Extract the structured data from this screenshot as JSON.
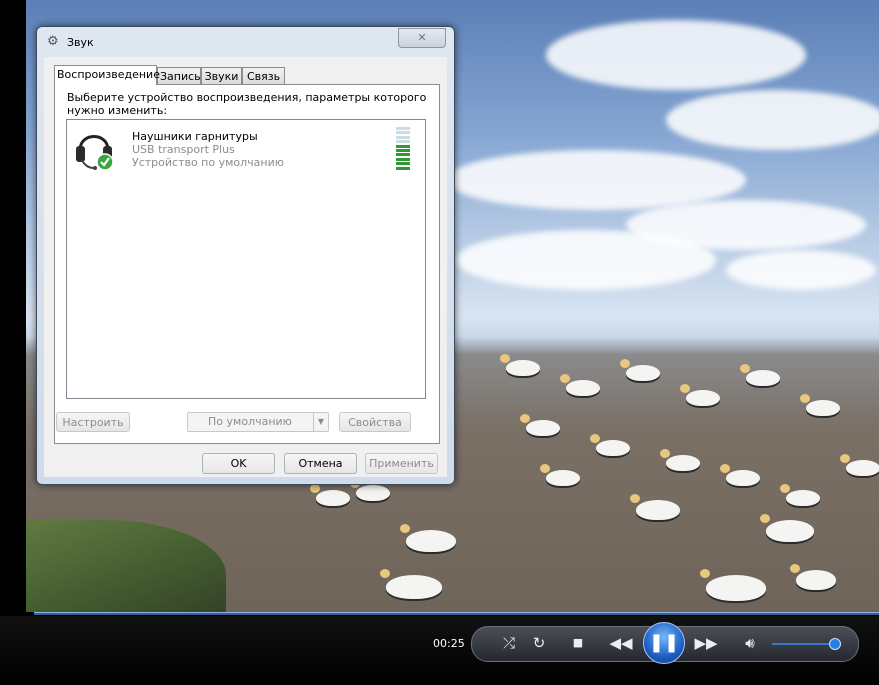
{
  "player": {
    "time": "00:25",
    "seek_progress": 1.0,
    "volume_level": 0.92,
    "icons": [
      "repeat-shuffle-icon",
      "repeat-icon",
      "stop-icon",
      "previous-icon",
      "pause-icon",
      "next-icon",
      "volume-icon"
    ]
  },
  "dialog": {
    "title": "Звук",
    "tabs": [
      "Воспроизведение",
      "Запись",
      "Звуки",
      "Связь"
    ],
    "active_tab": "Воспроизведение",
    "instruction": "Выберите устройство воспроизведения, параметры которого нужно изменить:",
    "device": {
      "name": "Наушники гарнитуры",
      "subtitle": "USB transport Plus",
      "status": "Устройство по умолчанию",
      "level_segments_lit": 6,
      "level_segments_total": 10
    },
    "buttons": {
      "configure": "Настроить",
      "set_default": "По умолчанию",
      "properties": "Свойства",
      "ok": "OK",
      "cancel": "Отмена",
      "apply": "Применить"
    }
  },
  "colors": {
    "accent": "#1c5fc2",
    "meter_on": "#2f9a33",
    "meter_off": "#c9dde2"
  }
}
